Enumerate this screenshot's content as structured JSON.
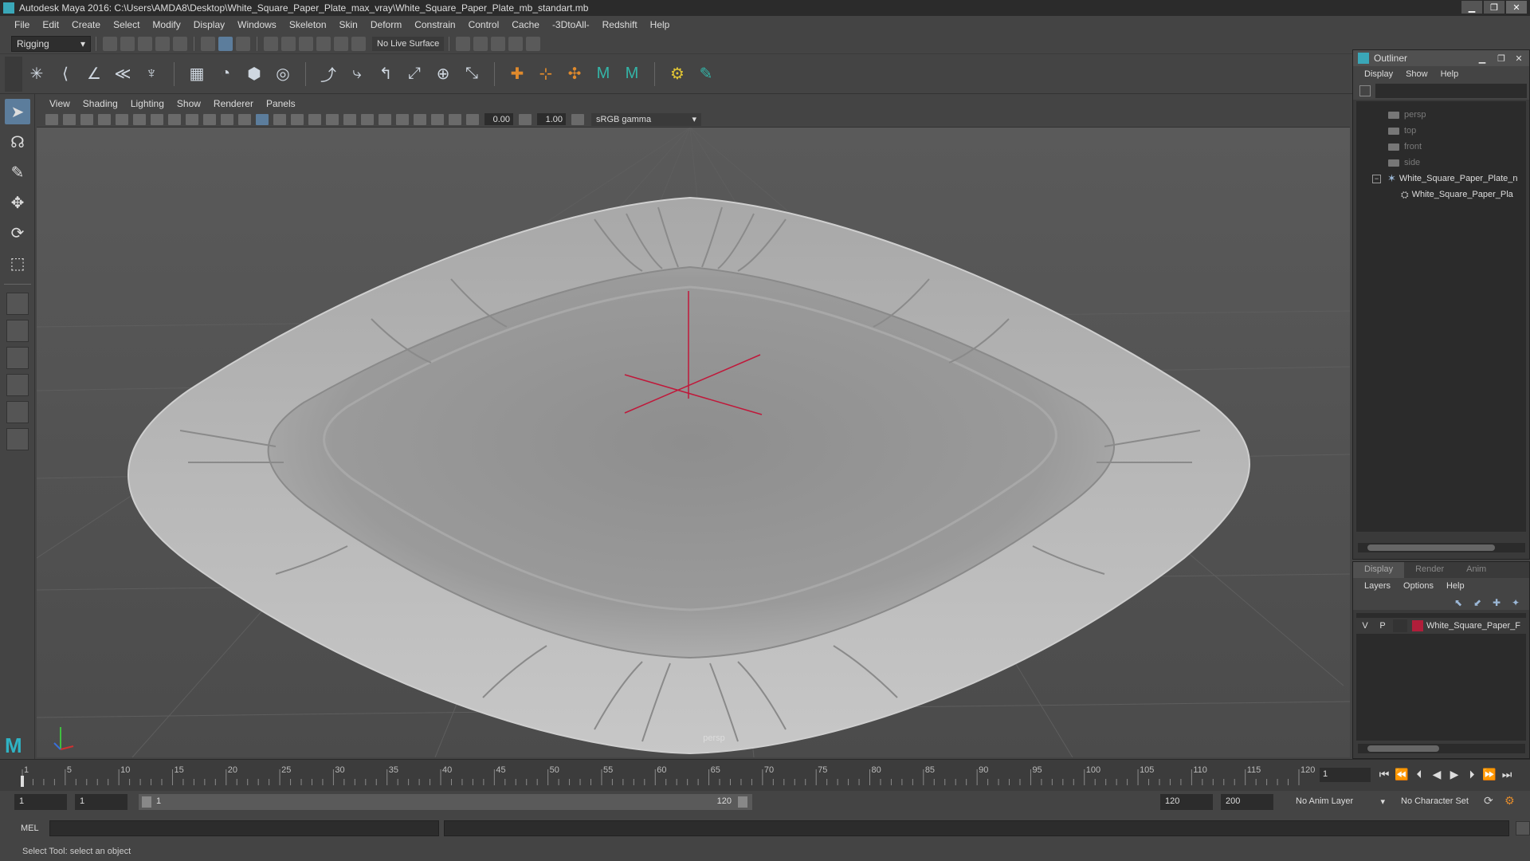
{
  "window": {
    "title": "Autodesk Maya 2016: C:\\Users\\AMDA8\\Desktop\\White_Square_Paper_Plate_max_vray\\White_Square_Paper_Plate_mb_standart.mb",
    "minimize": "▁",
    "maximize": "❐",
    "close": "✕"
  },
  "menubar": [
    "File",
    "Edit",
    "Create",
    "Select",
    "Modify",
    "Display",
    "Windows",
    "Skeleton",
    "Skin",
    "Deform",
    "Constrain",
    "Control",
    "Cache",
    "-3DtoAll-",
    "Redshift",
    "Help"
  ],
  "statusline": {
    "mode": "Rigging",
    "live_surface": "No Live Surface"
  },
  "viewport": {
    "menu": [
      "View",
      "Shading",
      "Lighting",
      "Show",
      "Renderer",
      "Panels"
    ],
    "exposure": "0.00",
    "gamma": "1.00",
    "color_space": "sRGB gamma",
    "camera_label": "persp"
  },
  "outliner": {
    "title": "Outliner",
    "menu": [
      "Display",
      "Show",
      "Help"
    ],
    "items": [
      {
        "label": "persp"
      },
      {
        "label": "top"
      },
      {
        "label": "front"
      },
      {
        "label": "side"
      },
      {
        "label": "White_Square_Paper_Plate_n"
      },
      {
        "label": "White_Square_Paper_Pla"
      }
    ]
  },
  "layer_editor": {
    "tabs": [
      "Display",
      "Render",
      "Anim"
    ],
    "menu": [
      "Layers",
      "Options",
      "Help"
    ],
    "layer": {
      "v": "V",
      "p": "P",
      "name": "White_Square_Paper_F",
      "color": "#b01e3a"
    }
  },
  "timeslider": {
    "ticks": [
      "1",
      "5",
      "10",
      "15",
      "20",
      "25",
      "30",
      "35",
      "40",
      "45",
      "50",
      "55",
      "60",
      "65",
      "70",
      "75",
      "80",
      "85",
      "90",
      "95",
      "100",
      "105",
      "110",
      "115",
      "120"
    ],
    "current_frame": "1"
  },
  "rangeslider": {
    "start": "1",
    "playback_start": "1",
    "range_start": "1",
    "range_end": "120",
    "playback_end": "120",
    "end": "200",
    "anim_layer": "No Anim Layer",
    "character_set": "No Character Set"
  },
  "cmdline": {
    "label": "MEL"
  },
  "helpline": {
    "text": "Select Tool: select an object"
  },
  "colors": {
    "accent": "#5c7d9c",
    "pivot": "#c0183a",
    "layer": "#b01e3a"
  }
}
